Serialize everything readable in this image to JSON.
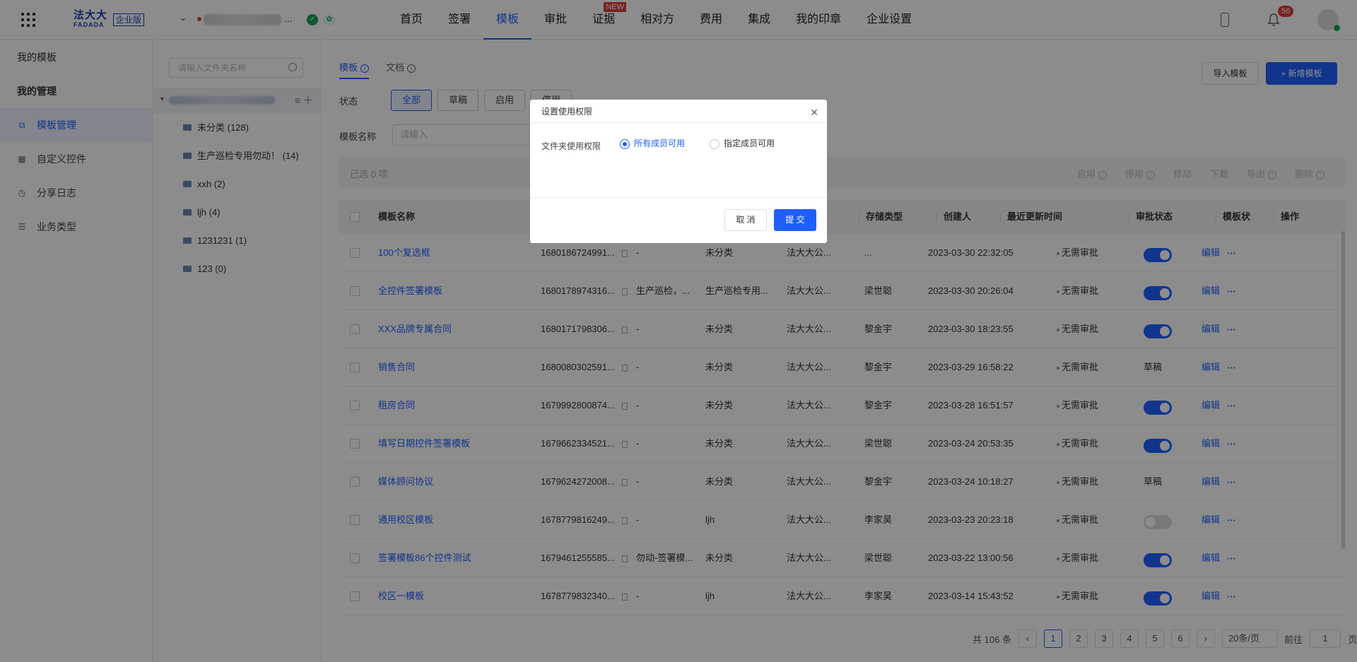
{
  "topbar": {
    "logo_cn": "法大大",
    "logo_en": "FADADA",
    "edition": "企业版",
    "company_ellipsis": "...",
    "nav": [
      {
        "label": "首页"
      },
      {
        "label": "签署"
      },
      {
        "label": "模板"
      },
      {
        "label": "审批"
      },
      {
        "label": "证据",
        "tag": "NEW"
      },
      {
        "label": "相对方"
      },
      {
        "label": "费用"
      },
      {
        "label": "集成"
      },
      {
        "label": "我的印章"
      },
      {
        "label": "企业设置"
      }
    ],
    "active_nav": "模板",
    "notifications": "56"
  },
  "sidebar": {
    "section1": "我的模板",
    "section2": "我的管理",
    "items": [
      {
        "label": "模板管理",
        "icon": "template-icon"
      },
      {
        "label": "自定义控件",
        "icon": "custom-control-icon"
      },
      {
        "label": "分享日志",
        "icon": "clock-icon"
      },
      {
        "label": "业务类型",
        "icon": "list-icon"
      }
    ]
  },
  "folders": {
    "search_placeholder": "请输入文件夹名称",
    "items": [
      "未分类 (128)",
      "生产巡检专用勿动！ (14)",
      "xxh (2)",
      "ljh (4)",
      "1231231 (1)",
      "123 (0)"
    ]
  },
  "main": {
    "tabs": [
      "模板",
      "文档"
    ],
    "import_label": "导入模板",
    "new_label": "+ 新增模板",
    "status_label": "状态",
    "status_chips": [
      "全部",
      "草稿",
      "启用",
      "停用"
    ],
    "name_label": "模板名称",
    "name_placeholder": "请输入",
    "selected_text": "已选  0  项",
    "batch_actions": [
      "启用",
      "停用",
      "移动",
      "下载",
      "导出",
      "删除"
    ],
    "columns": [
      "模板名称",
      "",
      "",
      "",
      "存储类型",
      "创建人",
      "最近更新时间",
      "审批状态",
      "模板状",
      "操作"
    ],
    "rows": [
      {
        "name": "100个复选框",
        "id": "1680186724991...",
        "tag": "-",
        "folder": "未分类",
        "storage": "法大大公...",
        "creator": "...",
        "updated": "2023-03-30 22:32:05",
        "approval": "无需审批",
        "status": "on",
        "op": "编辑"
      },
      {
        "name": "全控件签署模板",
        "id": "1680178974316...",
        "tag": "生产巡检，...",
        "folder": "生产巡检专用...",
        "storage": "法大大公...",
        "creator": "梁世聪",
        "updated": "2023-03-30 20:26:04",
        "approval": "无需审批",
        "status": "on",
        "op": "编辑"
      },
      {
        "name": "XXX品牌专属合同",
        "id": "1680171798306...",
        "tag": "-",
        "folder": "未分类",
        "storage": "法大大公...",
        "creator": "黎金宇",
        "updated": "2023-03-30 18:23:55",
        "approval": "无需审批",
        "status": "on",
        "op": "编辑"
      },
      {
        "name": "销售合同",
        "id": "1680080302591...",
        "tag": "-",
        "folder": "未分类",
        "storage": "法大大公...",
        "creator": "黎金宇",
        "updated": "2023-03-29 16:58:22",
        "approval": "无需审批",
        "status": "草稿",
        "op": "编辑"
      },
      {
        "name": "租房合同",
        "id": "1679992800874...",
        "tag": "-",
        "folder": "未分类",
        "storage": "法大大公...",
        "creator": "黎金宇",
        "updated": "2023-03-28 16:51:57",
        "approval": "无需审批",
        "status": "on",
        "op": "编辑"
      },
      {
        "name": "填写日期控件签署模板",
        "id": "1679662334521...",
        "tag": "-",
        "folder": "未分类",
        "storage": "法大大公...",
        "creator": "梁世聪",
        "updated": "2023-03-24 20:53:35",
        "approval": "无需审批",
        "status": "on",
        "op": "编辑"
      },
      {
        "name": "媒体顾问协议",
        "id": "1679624272008...",
        "tag": "-",
        "folder": "未分类",
        "storage": "法大大公...",
        "creator": "黎金宇",
        "updated": "2023-03-24 10:18:27",
        "approval": "无需审批",
        "status": "草稿",
        "op": "编辑"
      },
      {
        "name": "通用校区模板",
        "id": "1678779816249...",
        "tag": "-",
        "folder": "ljh",
        "storage": "法大大公...",
        "creator": "李家昊",
        "updated": "2023-03-23 20:23:18",
        "approval": "无需审批",
        "status": "off",
        "op": "编辑"
      },
      {
        "name": "签署模板86个控件测试",
        "id": "1679461255585...",
        "tag": "勿动-签署模...",
        "folder": "未分类",
        "storage": "法大大公...",
        "creator": "梁世聪",
        "updated": "2023-03-22 13:00:56",
        "approval": "无需审批",
        "status": "on",
        "op": "编辑"
      },
      {
        "name": "校区一模板",
        "id": "1678779832340...",
        "tag": "-",
        "folder": "ljh",
        "storage": "法大大公...",
        "creator": "李家昊",
        "updated": "2023-03-14 15:43:52",
        "approval": "无需审批",
        "status": "on",
        "op": "编辑"
      }
    ],
    "pager": {
      "total": "共 106 条",
      "pages": [
        "1",
        "2",
        "3",
        "4",
        "5",
        "6"
      ],
      "current": "1",
      "page_size": "20条/页",
      "goto_label": "前往",
      "goto_value": "1",
      "page_suffix": "页"
    }
  },
  "modal": {
    "title": "设置使用权限",
    "label": "文件夹使用权限",
    "options": [
      "所有成员可用",
      "指定成员可用"
    ],
    "selected": "所有成员可用",
    "cancel": "取 消",
    "submit": "提 交"
  },
  "colors": {
    "accent": "#1f5fff",
    "brand": "#1f3fb8",
    "danger": "#e03c3c",
    "success": "#19a35b"
  }
}
